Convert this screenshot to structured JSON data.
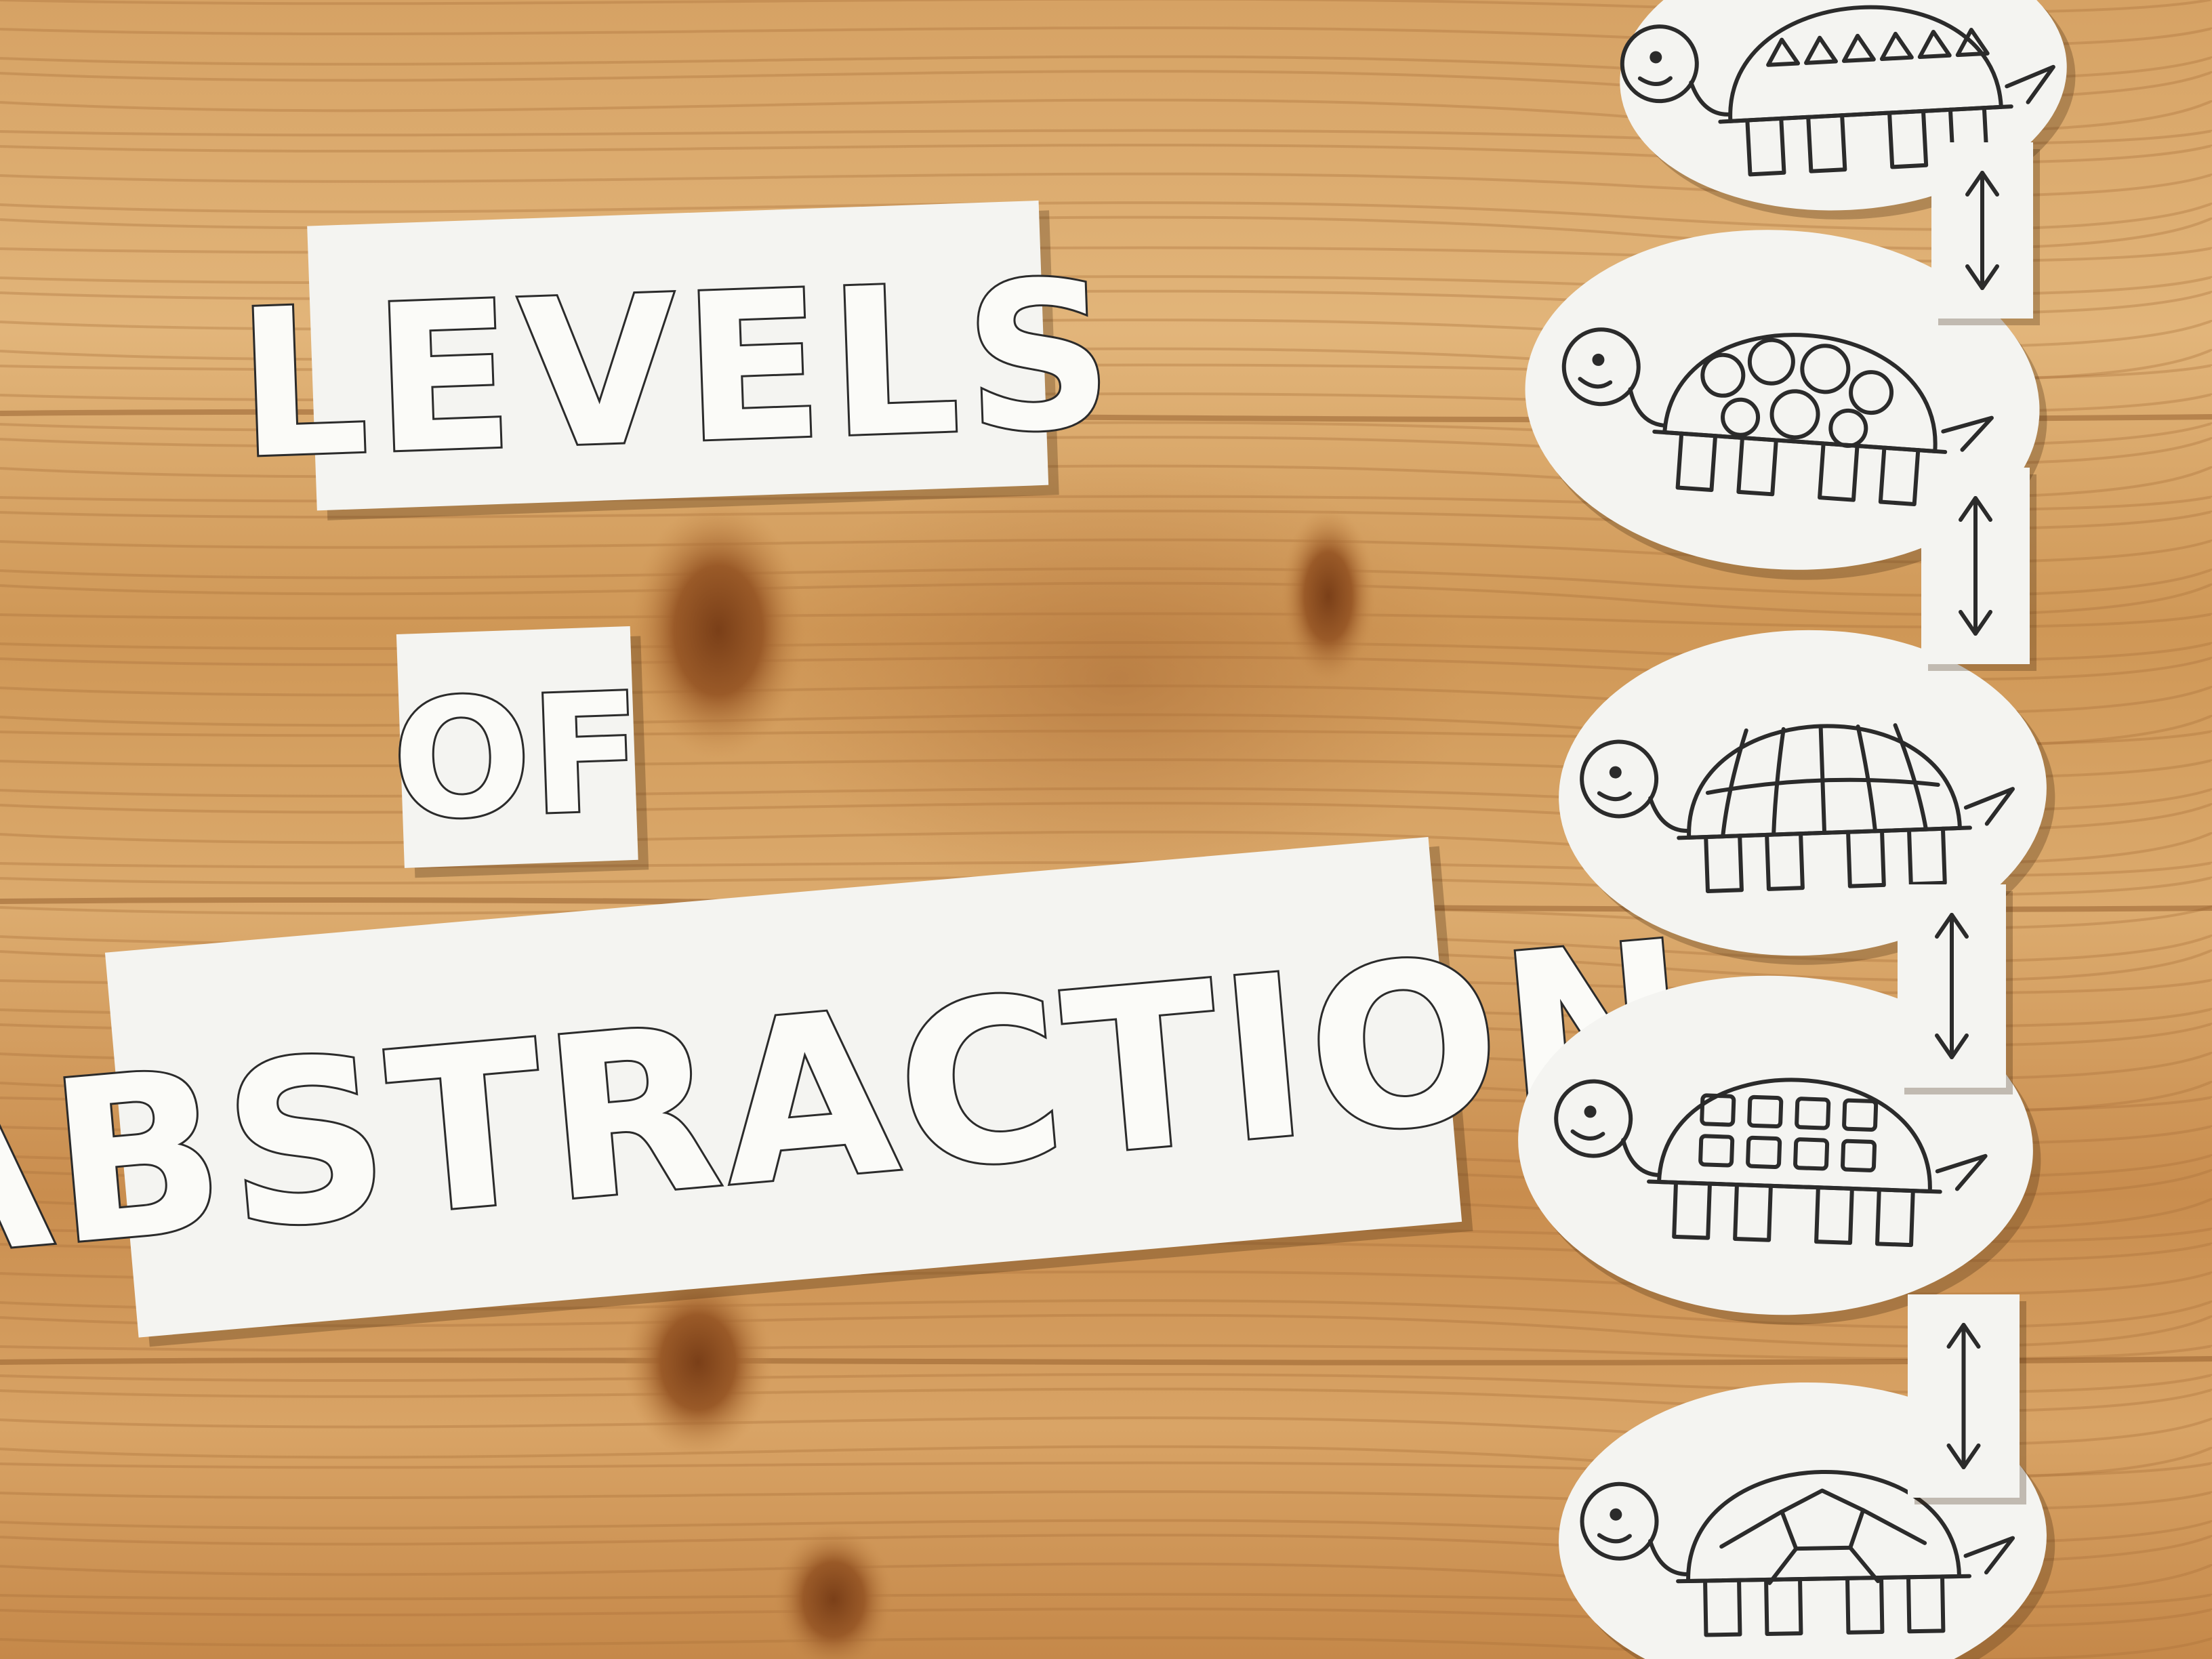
{
  "title_cards": {
    "line1": "LEVELS",
    "line2": "OF",
    "line3": "ABSTRACTION"
  },
  "turtles": [
    {
      "pattern": "triangles"
    },
    {
      "pattern": "circles"
    },
    {
      "pattern": "stripes"
    },
    {
      "pattern": "squares"
    },
    {
      "pattern": "mosaic"
    }
  ],
  "connectors": [
    {
      "icon": "double-arrow-icon"
    },
    {
      "icon": "double-arrow-icon"
    },
    {
      "icon": "double-arrow-icon"
    },
    {
      "icon": "double-arrow-icon"
    }
  ],
  "colors": {
    "wood_light": "#d9a86a",
    "wood_mid": "#c98f4f",
    "wood_dark": "#9a5f2c",
    "paper": "#f4f4f1",
    "ink": "#2b2b2b"
  }
}
